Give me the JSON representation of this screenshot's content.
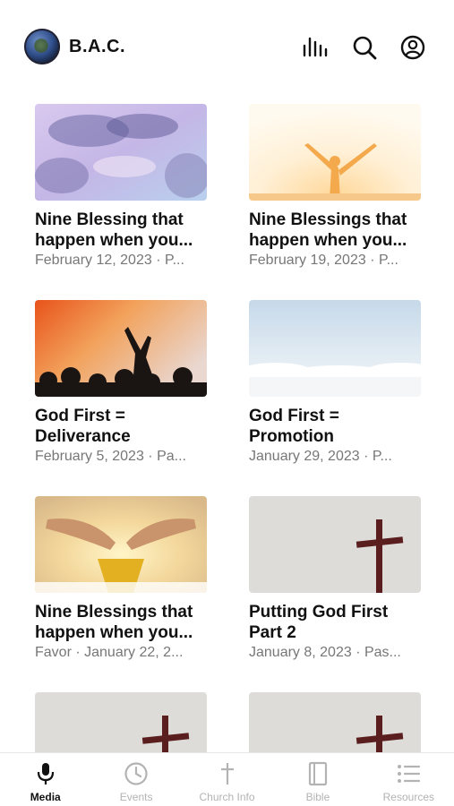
{
  "header": {
    "app_name": "B.A.C.",
    "icons": [
      "logo-globe",
      "audio-bars-icon",
      "search-icon",
      "account-icon"
    ]
  },
  "media_items": [
    {
      "title": "Nine Blessing that happen when you...",
      "subtitle": "February 12, 2023 · P...",
      "image": "purple-clouds"
    },
    {
      "title": "Nine Blessings that happen when you...",
      "subtitle": "February 19, 2023 · P...",
      "image": "raised-arms-sunrise"
    },
    {
      "title": "God First = Deliverance",
      "subtitle": "February 5, 2023 · Pa...",
      "image": "worship-crowd"
    },
    {
      "title": "God First = Promotion",
      "subtitle": "January 29, 2023 · P...",
      "image": "sky-clouds"
    },
    {
      "title": "Nine Blessings that happen when you...",
      "subtitle": "Favor · January 22, 2...",
      "image": "open-hands-light"
    },
    {
      "title": "Putting God First Part 2",
      "subtitle": "January 8, 2023 · Pas...",
      "image": "cross-gray"
    },
    {
      "title": "",
      "subtitle": "",
      "image": "cross-gray"
    },
    {
      "title": "",
      "subtitle": "",
      "image": "cross-gray"
    }
  ],
  "tabbar": {
    "active": "Media",
    "tabs": [
      {
        "label": "Media",
        "icon": "microphone-icon"
      },
      {
        "label": "Events",
        "icon": "clock-icon"
      },
      {
        "label": "Church Info",
        "icon": "cross-icon"
      },
      {
        "label": "Bible",
        "icon": "book-icon"
      },
      {
        "label": "Resources",
        "icon": "list-icon"
      }
    ]
  },
  "colors": {
    "active_tab": "#111111",
    "inactive_tab": "#b3b3b3",
    "subtitle": "#777777"
  }
}
